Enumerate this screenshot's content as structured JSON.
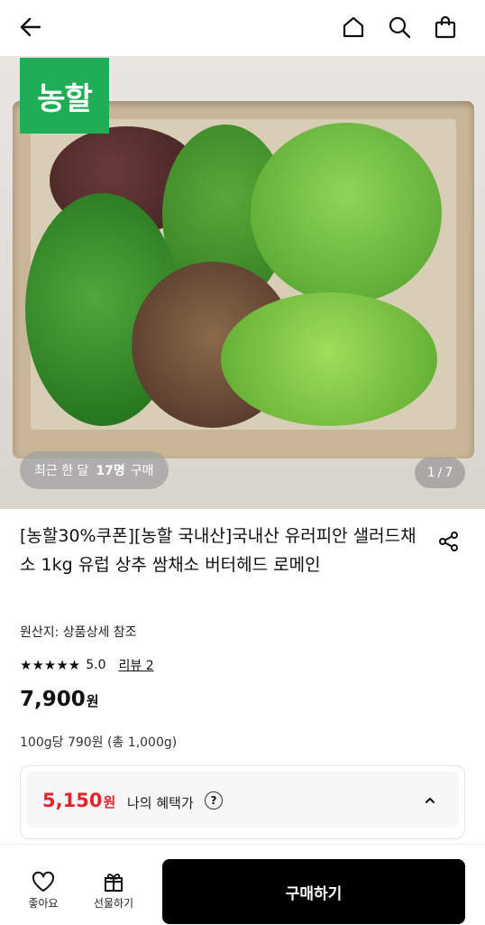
{
  "header": {
    "back_icon": "back-arrow-icon",
    "home_icon": "home-icon",
    "search_icon": "search-icon",
    "cart_icon": "shopping-bag-icon"
  },
  "hero": {
    "brand_badge": "농할",
    "purchase_prefix": "최근 한 달",
    "purchase_count": "17명",
    "purchase_suffix": "구매",
    "page_current": "1",
    "page_separator": "/",
    "page_total": "7"
  },
  "product": {
    "title": "[농할30%쿠폰][농할 국내산]국내산 유러피안 샐러드채소 1kg 유럽 상추 쌈채소 버터헤드 로메인",
    "origin": "원산지: 상품상세 참조",
    "stars": "★★★★★",
    "rating": "5.0",
    "review_link": "리뷰 2",
    "price": "7,900",
    "price_unit": "원",
    "unit_price": "100g당 790원 (총 1,000g)"
  },
  "benefit": {
    "price": "5,150",
    "price_unit": "원",
    "label": "나의 혜택가",
    "help": "?"
  },
  "bottom": {
    "like_label": "좋아요",
    "gift_label": "선물하기",
    "buy_label": "구매하기"
  },
  "colors": {
    "brand_green": "#1fae55",
    "benefit_red": "#e0262b",
    "buy_button": "#000000"
  }
}
